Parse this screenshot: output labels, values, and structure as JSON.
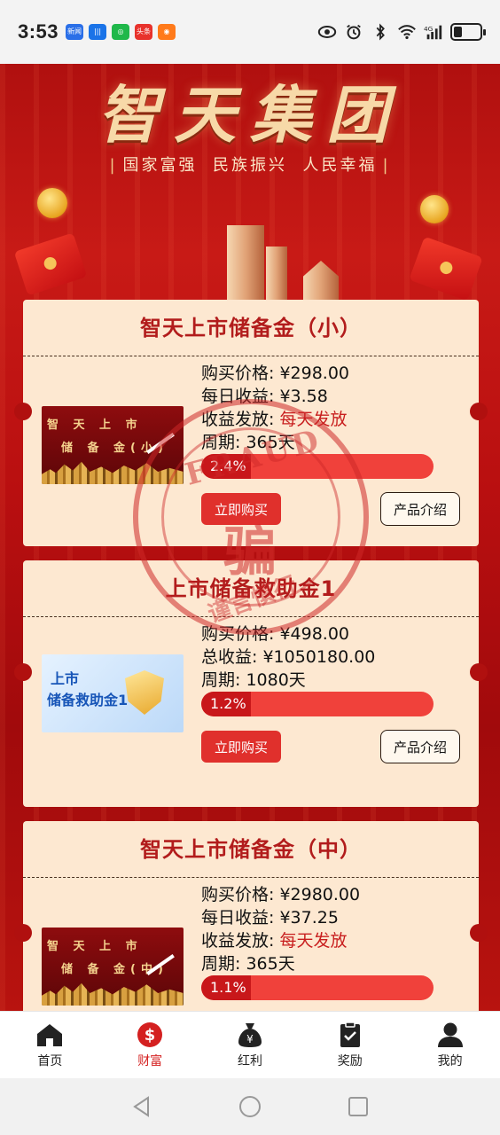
{
  "status_bar": {
    "time": "3:53",
    "notifications": [
      {
        "name": "news-app-icon",
        "color": "#2a6fe8",
        "text": "新闻"
      },
      {
        "name": "audio-app-icon",
        "color": "#1a73e8",
        "text": "|||"
      },
      {
        "name": "chat-app-icon",
        "color": "#1fb84a",
        "text": "◎"
      },
      {
        "name": "toutiao-app-icon",
        "color": "#e8322c",
        "text": "头条"
      },
      {
        "name": "browser-app-icon",
        "color": "#ff7a1a",
        "text": "◉"
      }
    ],
    "network": "4G"
  },
  "hero": {
    "title": "智天集团",
    "slogan": [
      "国家富强",
      "民族振兴",
      "人民幸福"
    ]
  },
  "products": [
    {
      "title": "智天上市储备金（小）",
      "thumb": {
        "line1": "智 天 上 市",
        "line2": "储 备 金(小)"
      },
      "lines": [
        {
          "label": "购买价格: ",
          "value": "¥298.00",
          "red": false
        },
        {
          "label": "每日收益: ",
          "value": "¥3.58",
          "red": false
        },
        {
          "label": "收益发放: ",
          "value": "每天发放",
          "red": true
        },
        {
          "label": "周期: ",
          "value": "365天",
          "red": false
        }
      ],
      "progress_text": "2.4%",
      "progress": 0.024,
      "buy_label": "立即购买",
      "intro_label": "产品介绍"
    },
    {
      "title": "上市储备救助金1",
      "thumb": {
        "line1": "上市",
        "line2": "储备救助金1"
      },
      "lines": [
        {
          "label": "购买价格: ",
          "value": "¥498.00",
          "red": false
        },
        {
          "label": "总收益: ",
          "value": "¥1050180.00",
          "red": false
        },
        {
          "label": "周期: ",
          "value": "1080天",
          "red": false
        }
      ],
      "progress_text": "1.2%",
      "progress": 0.012,
      "buy_label": "立即购买",
      "intro_label": "产品介绍"
    },
    {
      "title": "智天上市储备金（中）",
      "thumb": {
        "line1": "智 天 上 市",
        "line2": "储 备 金(中)"
      },
      "lines": [
        {
          "label": "购买价格: ",
          "value": "¥2980.00",
          "red": false
        },
        {
          "label": "每日收益: ",
          "value": "¥37.25",
          "red": false
        },
        {
          "label": "收益发放: ",
          "value": "每天发放",
          "red": true
        },
        {
          "label": "周期: ",
          "value": "365天",
          "red": false
        }
      ],
      "progress_text": "1.1%",
      "progress": 0.011
    }
  ],
  "stamp": {
    "word": "FRAUD",
    "char": "骗",
    "sub": "谨言慎行"
  },
  "tabbar": [
    {
      "label": "首页",
      "icon": "home-icon",
      "active": false
    },
    {
      "label": "财富",
      "icon": "wealth-icon",
      "active": true
    },
    {
      "label": "红利",
      "icon": "money-bag-icon",
      "active": false
    },
    {
      "label": "奖励",
      "icon": "clipboard-check-icon",
      "active": false
    },
    {
      "label": "我的",
      "icon": "user-icon",
      "active": false
    }
  ],
  "colors": {
    "primary_red": "#d42020",
    "card_bg": "#fde8d1",
    "hero_red": "#b0100f"
  }
}
